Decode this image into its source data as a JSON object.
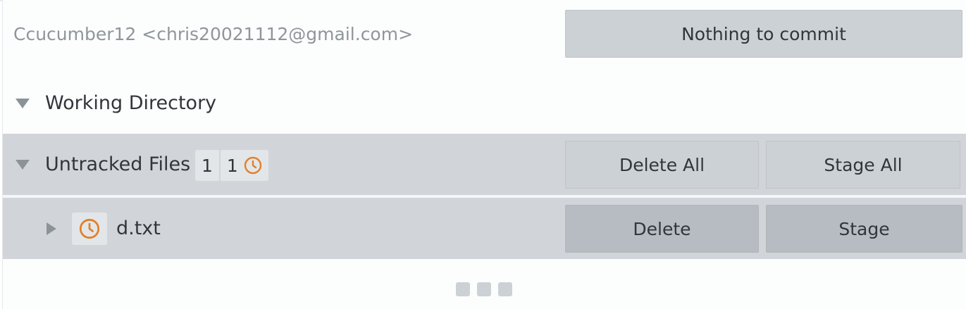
{
  "commit": {
    "author": "Ccucumber12 <chris20021112@gmail.com>",
    "button_label": "Nothing to commit"
  },
  "working_directory": {
    "title": "Working Directory"
  },
  "untracked": {
    "title": "Untracked Files",
    "count": "1",
    "untracked_count": "1",
    "delete_all_label": "Delete All",
    "stage_all_label": "Stage All"
  },
  "files": [
    {
      "name": "d.txt",
      "status_icon": "clock-icon",
      "delete_label": "Delete",
      "stage_label": "Stage"
    }
  ],
  "colors": {
    "accent_orange": "#e0812a",
    "row_background": "#d1d5d9",
    "button_background": "#ccd1d6"
  }
}
